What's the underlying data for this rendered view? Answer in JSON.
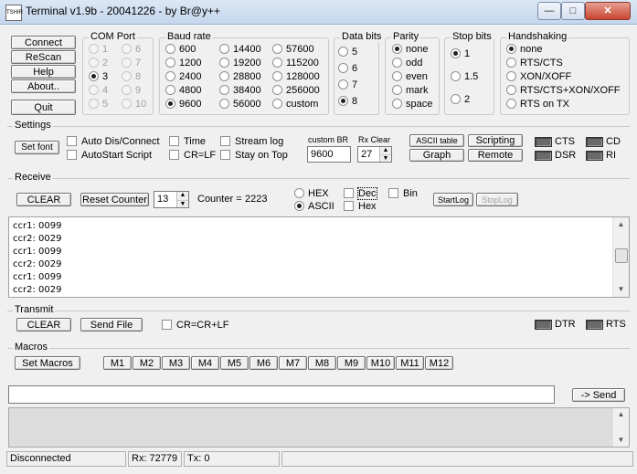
{
  "window": {
    "title": "Terminal v1.9b - 20041226 - by Br@y++",
    "icon_text": "TSHIR",
    "minimize": "—",
    "maximize": "□",
    "close": "✕"
  },
  "left_buttons": {
    "connect": "Connect",
    "rescan": "ReScan",
    "help": "Help",
    "about": "About..",
    "quit": "Quit"
  },
  "com_port": {
    "label": "COM Port",
    "options": [
      "1",
      "2",
      "3",
      "4",
      "5",
      "6",
      "7",
      "8",
      "9",
      "10"
    ],
    "selected": "3"
  },
  "baud_rate": {
    "label": "Baud rate",
    "options": [
      "600",
      "1200",
      "2400",
      "4800",
      "9600",
      "14400",
      "19200",
      "28800",
      "38400",
      "56000",
      "57600",
      "115200",
      "128000",
      "256000",
      "custom"
    ],
    "selected": "9600"
  },
  "data_bits": {
    "label": "Data bits",
    "options": [
      "5",
      "6",
      "7",
      "8"
    ],
    "selected": "8"
  },
  "parity": {
    "label": "Parity",
    "options": [
      "none",
      "odd",
      "even",
      "mark",
      "space"
    ],
    "selected": "none"
  },
  "stop_bits": {
    "label": "Stop bits",
    "options": [
      "1",
      "1.5",
      "2"
    ],
    "selected": "1"
  },
  "handshaking": {
    "label": "Handshaking",
    "options": [
      "none",
      "RTS/CTS",
      "XON/XOFF",
      "RTS/CTS+XON/XOFF",
      "RTS on TX"
    ],
    "selected": "none"
  },
  "settings": {
    "label": "Settings",
    "set_font": "Set font",
    "auto_dis_connect": "Auto Dis/Connect",
    "autostart_script": "AutoStart Script",
    "time": "Time",
    "cr_lf": "CR=LF",
    "stream_log": "Stream log",
    "stay_on_top": "Stay on Top",
    "custom_br_label": "custom BR",
    "custom_br_value": "9600",
    "rx_clear_label": "Rx Clear",
    "rx_clear_value": "27",
    "ascii_table": "ASCII table",
    "graph": "Graph",
    "scripting": "Scripting",
    "remote": "Remote",
    "cts": "CTS",
    "cd": "CD",
    "dsr": "DSR",
    "ri": "RI"
  },
  "receive": {
    "label": "Receive",
    "clear": "CLEAR",
    "reset_counter": "Reset Counter",
    "counter_spin": "13",
    "counter_label": "Counter =",
    "counter_value": "2223",
    "hex": "HEX",
    "ascii": "ASCII",
    "format_selected": "ASCII",
    "dec": "Dec",
    "hex_chk": "Hex",
    "bin": "Bin",
    "startlog": "StartLog",
    "stoplog": "StopLog",
    "lines": [
      "ccr1: 0099",
      "ccr2: 0029",
      "ccr1: 0099",
      "ccr2: 0029",
      "ccr1: 0099",
      "ccr2: 0029"
    ]
  },
  "transmit": {
    "label": "Transmit",
    "clear": "CLEAR",
    "send_file": "Send File",
    "cr_crlf": "CR=CR+LF",
    "dtr": "DTR",
    "rts": "RTS"
  },
  "macros": {
    "label": "Macros",
    "set_macros": "Set Macros",
    "buttons": [
      "M1",
      "M2",
      "M3",
      "M4",
      "M5",
      "M6",
      "M7",
      "M8",
      "M9",
      "M10",
      "M11",
      "M12"
    ]
  },
  "send": {
    "input_value": "",
    "button": "-> Send"
  },
  "status_bar": {
    "connection": "Disconnected",
    "rx": "Rx: 72779",
    "tx": "Tx: 0"
  }
}
